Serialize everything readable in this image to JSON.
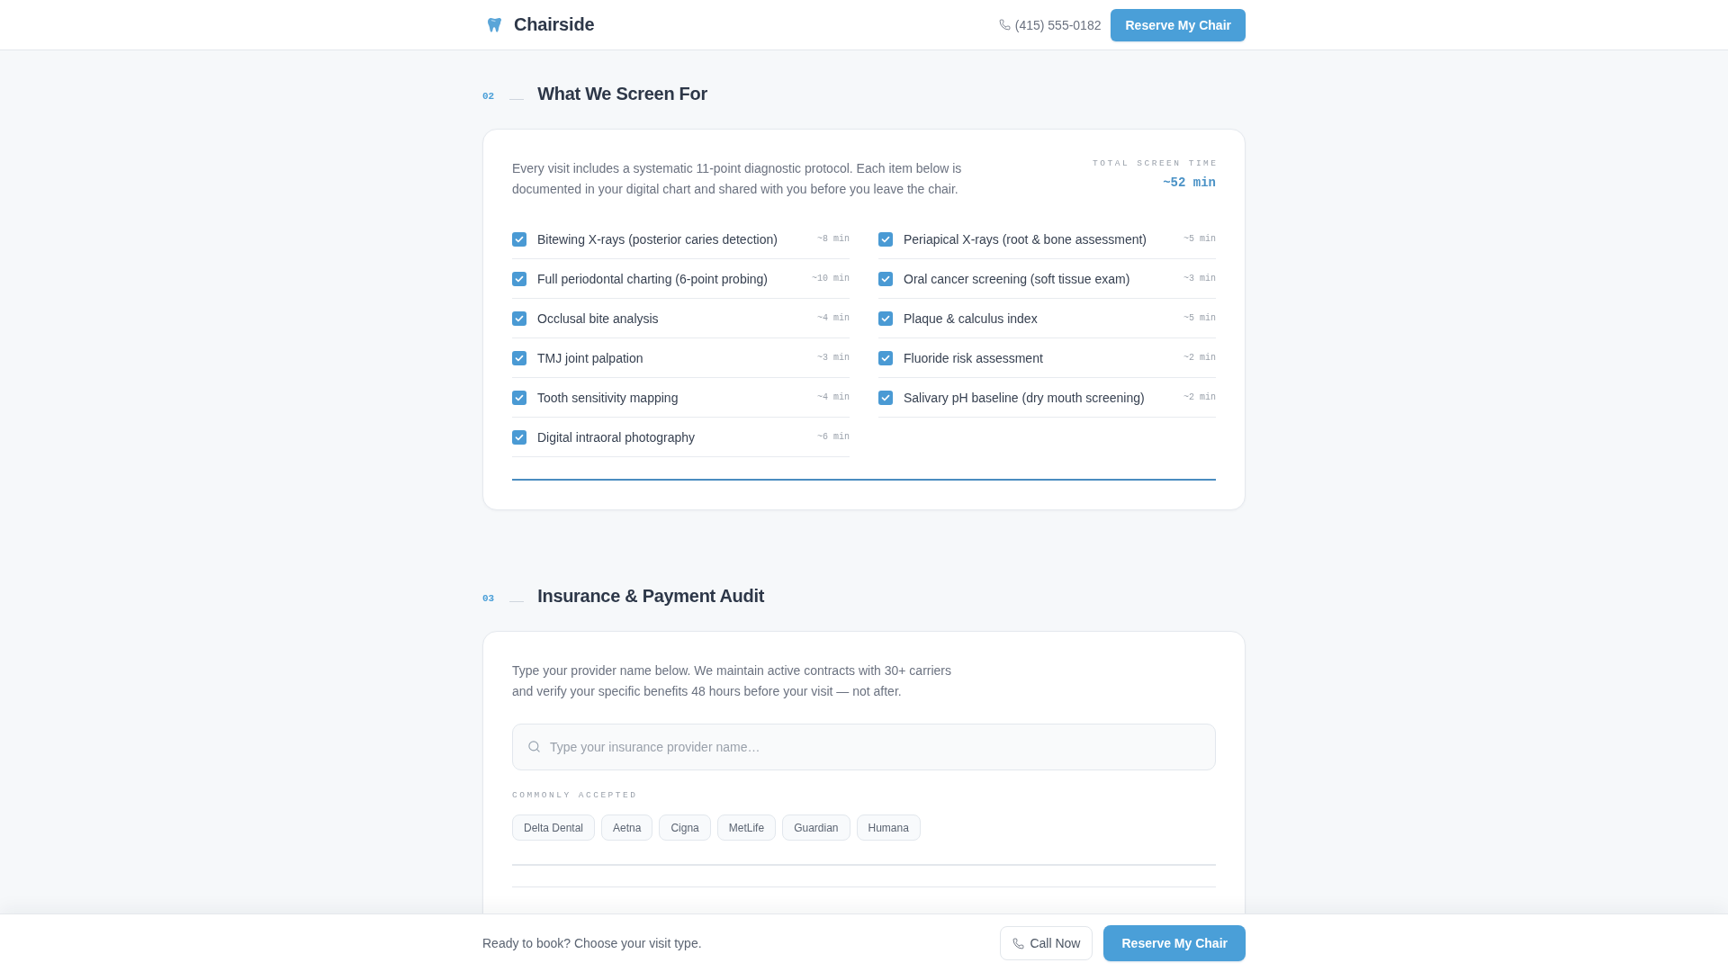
{
  "header": {
    "brand": "Chairside",
    "phone": "(415) 555-0182",
    "cta": "Reserve My Chair"
  },
  "sections": [
    {
      "kind": "checklist",
      "number": "02",
      "title": "What We Screen For",
      "intro": "Every visit includes a systematic 11-point diagnostic protocol. Each item below is documented in your digital chart and shared with you before you leave the chair.",
      "total": {
        "label": "TOTAL SCREEN TIME",
        "value": "~52 min"
      },
      "items": [
        {
          "label": "Bitewing X-rays (posterior caries detection)",
          "time": "~8 min",
          "checked": true
        },
        {
          "label": "Periapical X-rays (root & bone assessment)",
          "time": "~5 min",
          "checked": true
        },
        {
          "label": "Full periodontal charting (6-point probing)",
          "time": "~10 min",
          "checked": true
        },
        {
          "label": "Oral cancer screening (soft tissue exam)",
          "time": "~3 min",
          "checked": true
        },
        {
          "label": "Occlusal bite analysis",
          "time": "~4 min",
          "checked": true
        },
        {
          "label": "Plaque & calculus index",
          "time": "~5 min",
          "checked": true
        },
        {
          "label": "TMJ joint palpation",
          "time": "~3 min",
          "checked": true
        },
        {
          "label": "Fluoride risk assessment",
          "time": "~2 min",
          "checked": true
        },
        {
          "label": "Tooth sensitivity mapping",
          "time": "~4 min",
          "checked": true
        },
        {
          "label": "Salivary pH baseline (dry mouth screening)",
          "time": "~2 min",
          "checked": true
        },
        {
          "label": "Digital intraoral photography",
          "time": "~6 min",
          "checked": true
        }
      ]
    },
    {
      "kind": "insurance",
      "number": "03",
      "title": "Insurance & Payment Audit",
      "intro": "Type your provider name below. We maintain active contracts with 30+ carriers and verify your specific benefits 48 hours before your visit — not after.",
      "search": {
        "placeholder": "Type your insurance provider name…"
      },
      "chips_label": "COMMONLY ACCEPTED",
      "chips": [
        "Delta Dental",
        "Aetna",
        "Cigna",
        "MetLife",
        "Guardian",
        "Humana"
      ]
    }
  ],
  "bottom_bar": {
    "text": "Ready to book? Choose your visit type.",
    "buttons": [
      {
        "kind": "secondary",
        "label": "Call Now"
      },
      {
        "kind": "primary",
        "label": "Reserve My Chair"
      }
    ]
  }
}
